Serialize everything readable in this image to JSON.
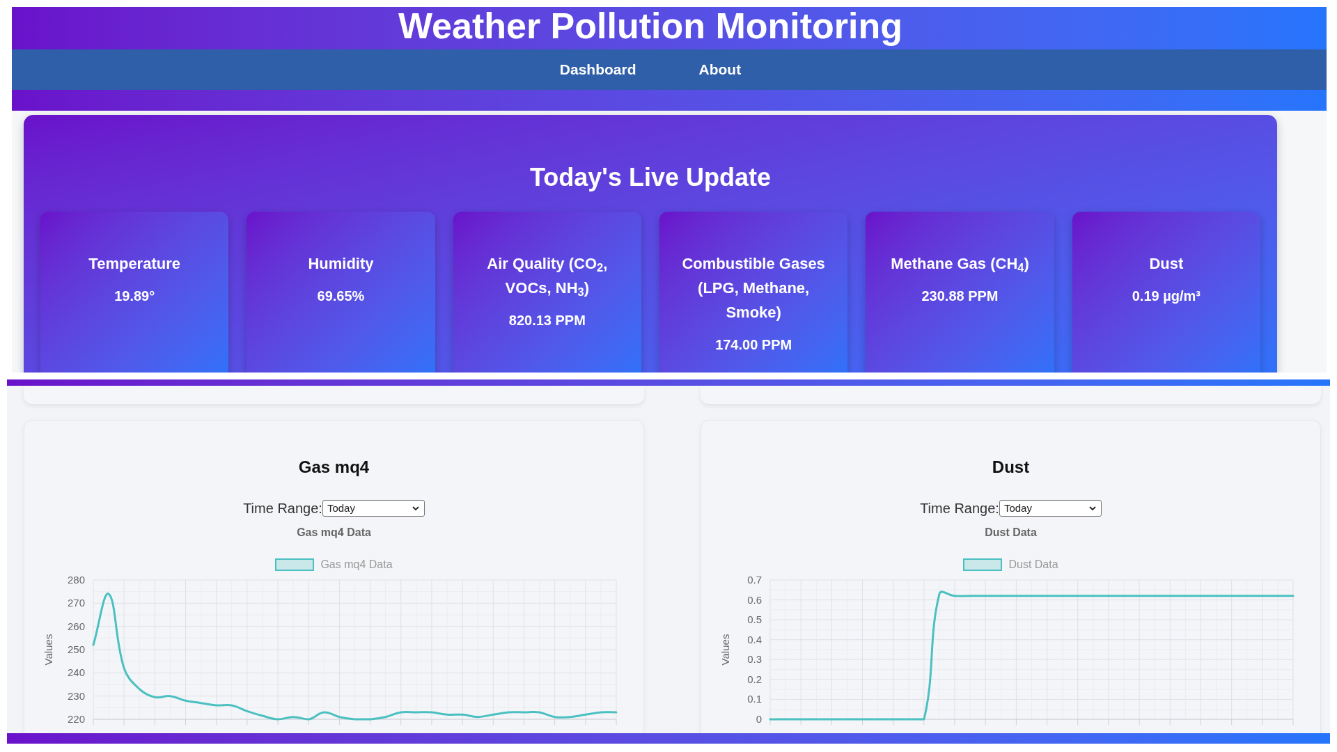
{
  "header": {
    "title": "Weather Pollution Monitoring",
    "nav": [
      {
        "label": "Dashboard"
      },
      {
        "label": "About"
      }
    ]
  },
  "live_update": {
    "title": "Today's Live Update",
    "cards": [
      {
        "label": "Temperature",
        "value": "19.89°"
      },
      {
        "label": "Humidity",
        "value": "69.65%"
      },
      {
        "label": "Air Quality (CO$_{2}$, VOCs, NH$_{3}$)",
        "value": "820.13 PPM"
      },
      {
        "label": "Combustible Gases (LPG, Methane, Smoke)",
        "value": "174.00 PPM"
      },
      {
        "label": "Methane Gas (CH$_{4}$)",
        "value": "230.88 PPM"
      },
      {
        "label": "Dust",
        "value": "0.19 µg/m³"
      }
    ]
  },
  "charts": [
    {
      "title": "Gas mq4",
      "time_range": {
        "label": "Time Range:",
        "value": "Today"
      },
      "chart_data": {
        "type": "line",
        "title": "Gas mq4 Data",
        "ylabel": "Values",
        "ylim": [
          220,
          280
        ],
        "yticks": [
          220,
          230,
          240,
          250,
          260,
          270,
          280
        ],
        "grid": true,
        "series": [
          {
            "name": "Gas mq4 Data",
            "color": "#4bc0c0",
            "values": [
              252,
              274,
              242,
              233,
              229.5,
              230,
              228,
              227,
              226,
              226,
              223.5,
              221.5,
              220,
              221,
              220,
              223,
              221,
              220,
              220,
              221,
              223,
              223,
              223,
              222,
              222,
              221,
              222,
              223,
              223,
              223,
              221,
              221,
              222,
              223,
              223
            ]
          }
        ]
      }
    },
    {
      "title": "Dust",
      "time_range": {
        "label": "Time Range:",
        "value": "Today"
      },
      "chart_data": {
        "type": "line",
        "title": "Dust Data",
        "ylabel": "Values",
        "ylim": [
          0,
          0.7
        ],
        "yticks": [
          0,
          0.1,
          0.2,
          0.3,
          0.4,
          0.5,
          0.6,
          0.7
        ],
        "grid": true,
        "series": [
          {
            "name": "Dust Data",
            "color": "#4bc0c0",
            "values": [
              0,
              0,
              0,
              0,
              0,
              0,
              0,
              0,
              0,
              0,
              0,
              0.63,
              0.62,
              0.62,
              0.62,
              0.62,
              0.62,
              0.62,
              0.62,
              0.62,
              0.62,
              0.62,
              0.62,
              0.62,
              0.62,
              0.62,
              0.62,
              0.62,
              0.62,
              0.62,
              0.62,
              0.62,
              0.62,
              0.62,
              0.62
            ]
          }
        ]
      }
    }
  ]
}
